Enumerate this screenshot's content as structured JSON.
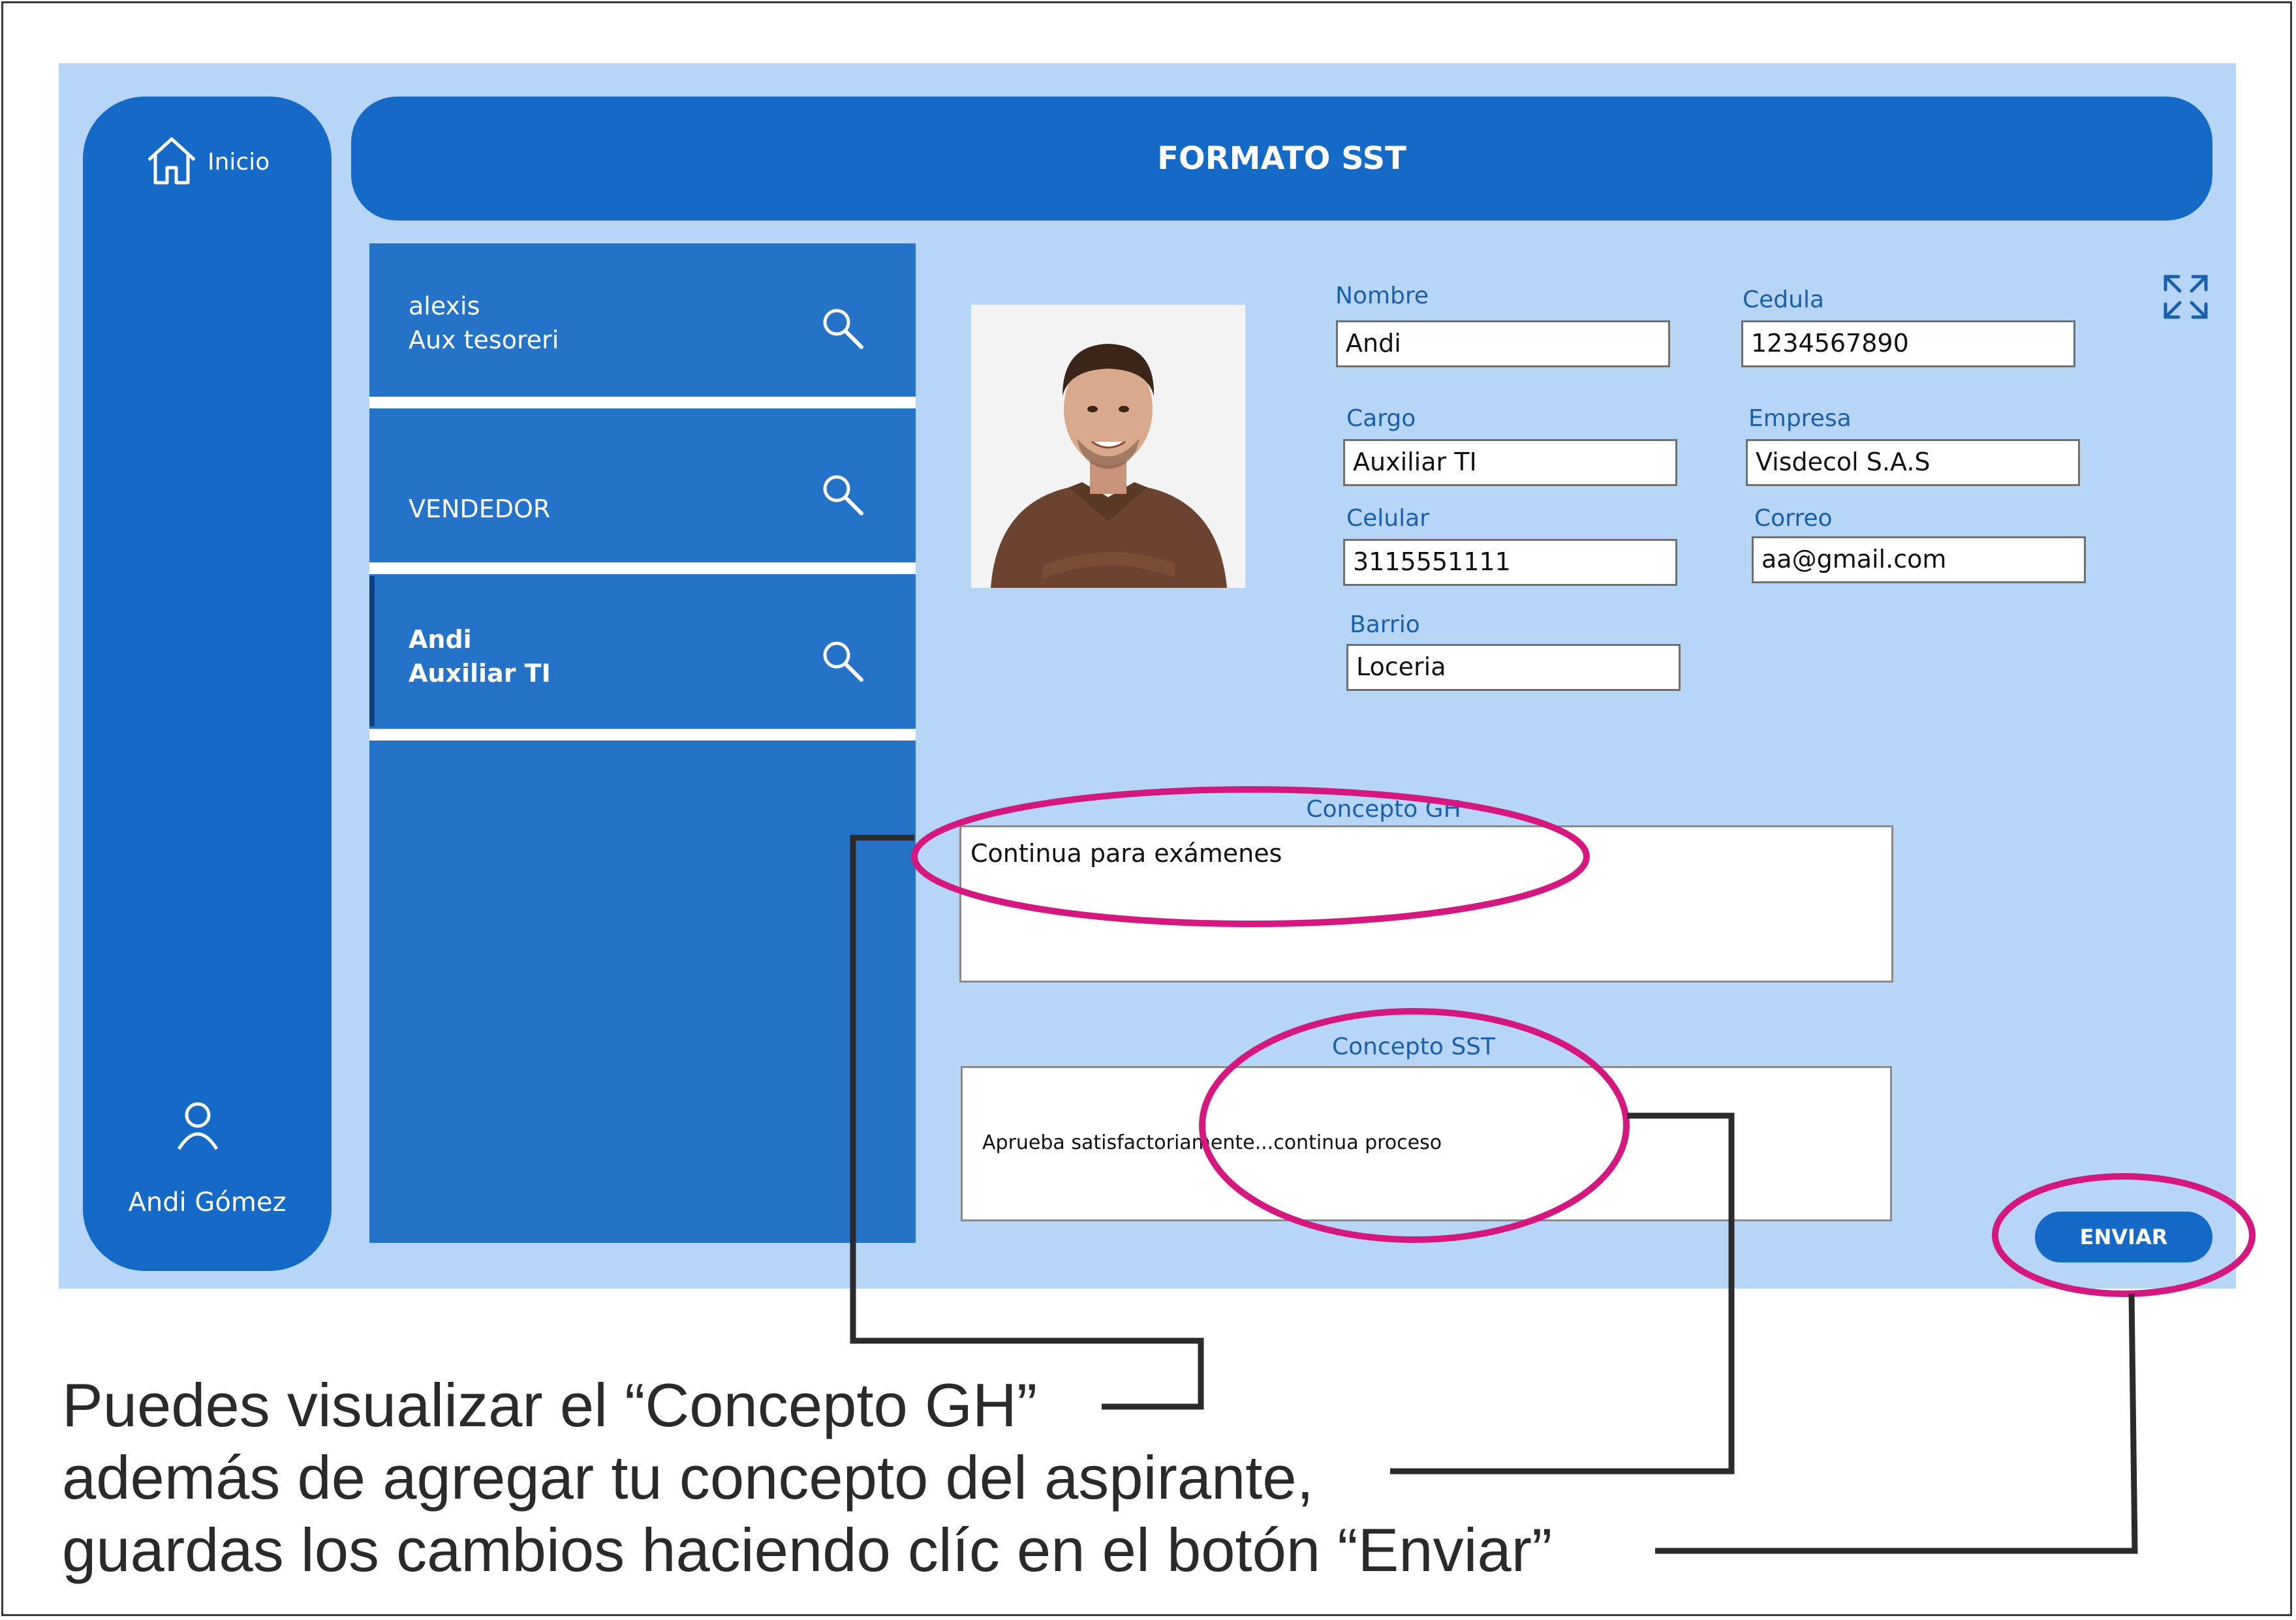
{
  "colors": {
    "app_bg": "#b7d6f7",
    "primary": "#1569c7",
    "gallery": "#2473c8",
    "label": "#1a5fae",
    "highlight": "#d5187f"
  },
  "nav": {
    "home_label": "Inicio",
    "home_icon": "home-icon",
    "user_icon": "user-icon",
    "user_name": "Andi Gómez"
  },
  "header": {
    "title": "FORMATO SST"
  },
  "gallery": {
    "items": [
      {
        "line1": "alexis",
        "line2": "Aux tesoreri",
        "icon": "search-icon"
      },
      {
        "line1": "",
        "line2": "VENDEDOR",
        "icon": "search-icon"
      },
      {
        "line1": "Andi",
        "line2": "Auxiliar TI",
        "icon": "search-icon",
        "selected": true
      }
    ]
  },
  "form": {
    "nombre_label": "Nombre",
    "nombre": "Andi",
    "cedula_label": "Cedula",
    "cedula": "1234567890",
    "cargo_label": "Cargo",
    "cargo": "Auxiliar TI",
    "empresa_label": "Empresa",
    "empresa": "Visdecol S.A.S",
    "celular_label": "Celular",
    "celular": "3115551111",
    "correo_label": "Correo",
    "correo": "aa@gmail.com",
    "barrio_label": "Barrio",
    "barrio": "Loceria"
  },
  "concepto_gh": {
    "label": "Concepto GH",
    "value": "Continua para exámenes"
  },
  "concepto_sst": {
    "label": "Concepto SST",
    "value": "Aprueba satisfactoriamente...continua proceso"
  },
  "submit_label": "ENVIAR",
  "instructions": [
    "Puedes visualizar el “Concepto GH”",
    "además de agregar tu concepto del aspirante,",
    "guardas los cambios haciendo clíc en el botón “Enviar”"
  ]
}
